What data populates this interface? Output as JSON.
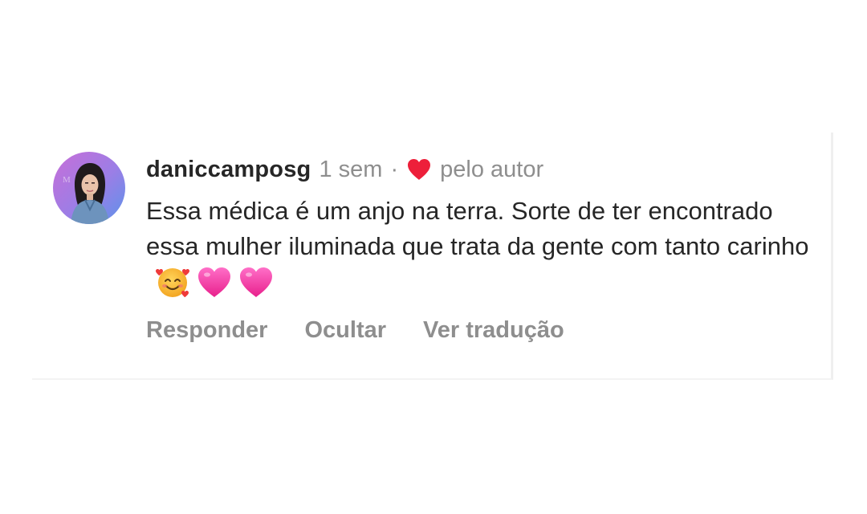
{
  "comment": {
    "username": "daniccamposg",
    "time_ago": "1 sem",
    "separator": "·",
    "liked_by_author_label": "pelo autor",
    "text": "Essa médica é um anjo na terra. Sorte de ter encontrado essa mulher iluminada que trata da gente com tanto carinho",
    "emojis": [
      "smiling-face-with-hearts-icon",
      "pink-heart-icon",
      "pink-heart-icon"
    ],
    "liked_by_author": true
  },
  "actions": {
    "reply_label": "Responder",
    "hide_label": "Ocultar",
    "translate_label": "Ver tradução"
  },
  "colors": {
    "text_primary": "#262626",
    "text_secondary": "#8e8e8e",
    "heart_red": "#ed1f3a",
    "pink_heart": "#f03c9f",
    "avatar_ring_start": "#c56bd6",
    "avatar_ring_end": "#5f8fe8"
  }
}
